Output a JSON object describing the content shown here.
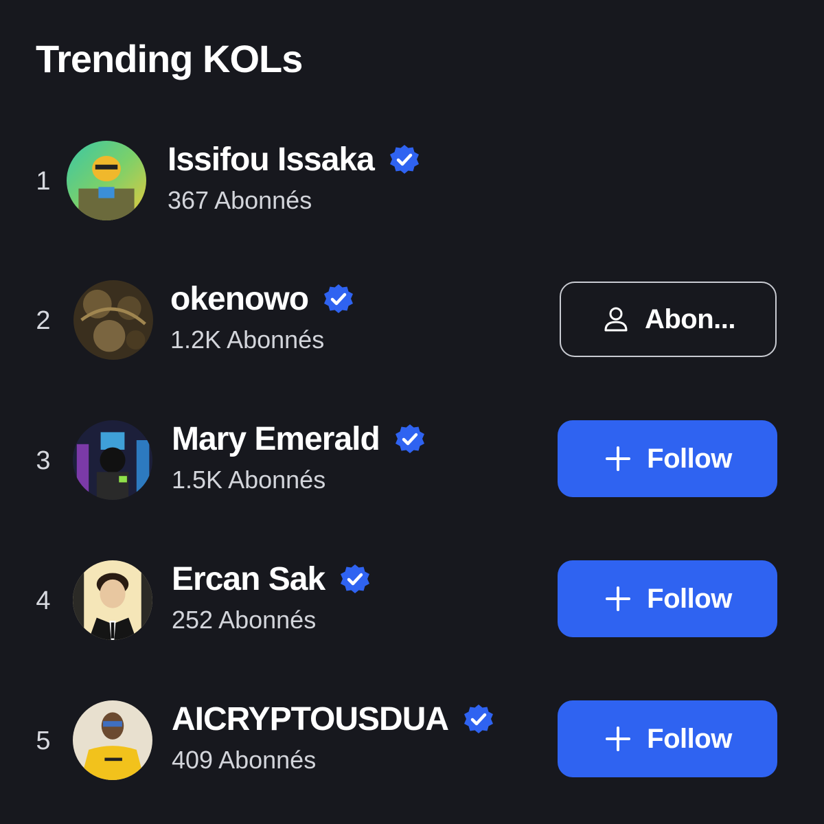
{
  "panel": {
    "title": "Trending KOLs"
  },
  "kols": [
    {
      "rank": "1",
      "name": "Issifou Issaka",
      "verified": true,
      "followers": "367 Abonnés",
      "action": null,
      "avatar_icon": "avatar-cartoon-character"
    },
    {
      "rank": "2",
      "name": "okenowo",
      "verified": true,
      "followers": "1.2K Abonnés",
      "action": {
        "type": "subscribed",
        "label": "Abon...",
        "icon": "user-icon"
      },
      "avatar_icon": "avatar-ornate-artwork"
    },
    {
      "rank": "3",
      "name": "Mary Emerald",
      "verified": true,
      "followers": "1.5K Abonnés",
      "action": {
        "type": "follow",
        "label": "Follow",
        "icon": "plus-icon"
      },
      "avatar_icon": "avatar-neon-cityscape"
    },
    {
      "rank": "4",
      "name": "Ercan Sak",
      "verified": true,
      "followers": "252 Abonnés",
      "action": {
        "type": "follow",
        "label": "Follow",
        "icon": "plus-icon"
      },
      "avatar_icon": "avatar-man-in-suit"
    },
    {
      "rank": "5",
      "name": "AICRYPTOUSDUA",
      "verified": true,
      "followers": "409 Abonnés",
      "action": {
        "type": "follow",
        "label": "Follow",
        "icon": "plus-icon"
      },
      "avatar_icon": "avatar-man-yellow-shirt"
    }
  ],
  "colors": {
    "background": "#17181e",
    "accent": "#2f63f1",
    "verified_badge": "#2f63f1",
    "secondary_text": "#d3d5db"
  }
}
